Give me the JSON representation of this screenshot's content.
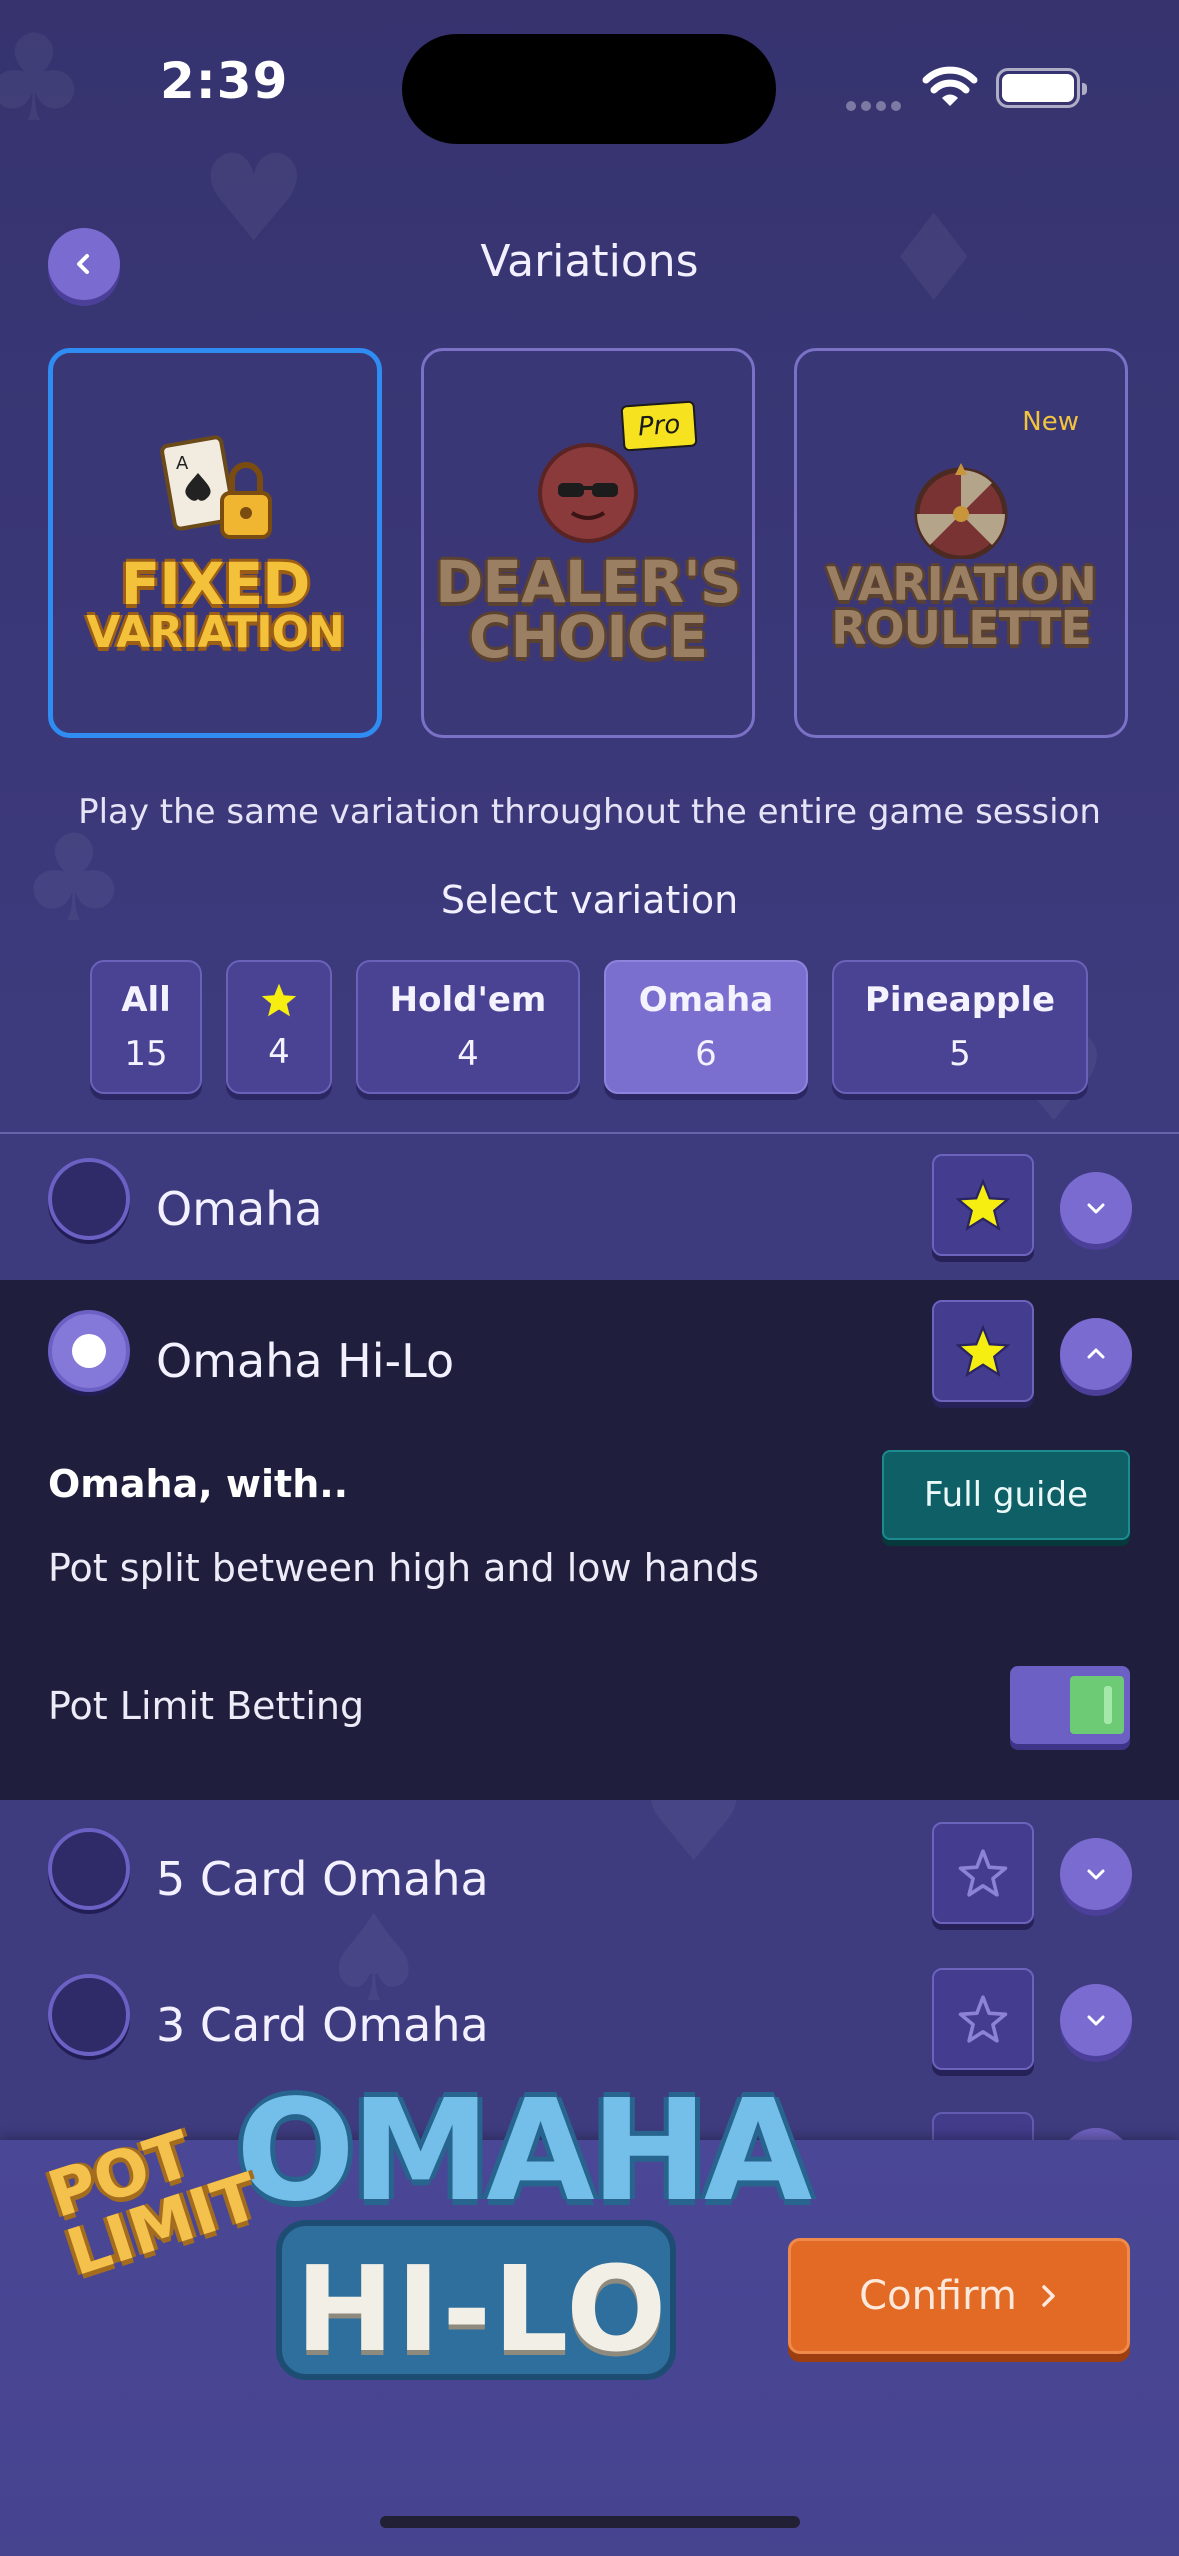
{
  "status_bar": {
    "time": "2:39"
  },
  "header": {
    "title": "Variations"
  },
  "modes": [
    {
      "name": "fixed",
      "line1": "FIXED",
      "line2": "VARIATION",
      "selected": true
    },
    {
      "name": "dealers-choice",
      "line1": "DEALER'S",
      "line2": "CHOICE",
      "badge": "Pro"
    },
    {
      "name": "roulette",
      "line1": "VARIATION",
      "line2": "ROULETTE",
      "badge": "New"
    }
  ],
  "description": "Play the same variation throughout the entire game session",
  "select_label": "Select variation",
  "filters": [
    {
      "label": "All",
      "count": "15"
    },
    {
      "label": "",
      "icon": "star-icon",
      "count": "4"
    },
    {
      "label": "Hold'em",
      "count": "4"
    },
    {
      "label": "Omaha",
      "count": "6",
      "active": true
    },
    {
      "label": "Pineapple",
      "count": "5"
    }
  ],
  "variations": [
    {
      "name": "Omaha",
      "favorite": true,
      "selected": false
    },
    {
      "name": "Omaha Hi-Lo",
      "favorite": true,
      "selected": true,
      "expanded": true
    },
    {
      "name": "5 Card Omaha",
      "favorite": false,
      "selected": false
    },
    {
      "name": "3 Card Omaha",
      "favorite": false,
      "selected": false
    }
  ],
  "details": {
    "title": "Omaha, with..",
    "text": "Pot split between high and low hands",
    "guide_label": "Full guide",
    "betting_label": "Pot Limit Betting",
    "betting_enabled": true
  },
  "logo": {
    "top": "OMAHA",
    "bottom": "HI-LO",
    "pot_line1": "POT",
    "pot_line2": "LIMIT"
  },
  "confirm_label": "Confirm",
  "colors": {
    "accent": "#7a6bd0",
    "selected_border": "#2f8cf2",
    "confirm": "#e26a25",
    "star": "#f6ee10"
  }
}
